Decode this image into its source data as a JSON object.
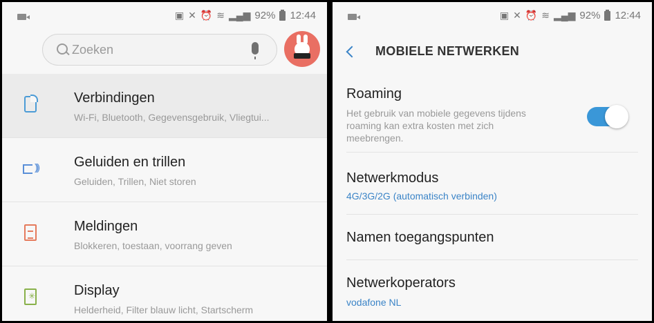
{
  "status_bar": {
    "battery": "92%",
    "time": "12:44",
    "icons": [
      "video-camera-icon",
      "nfc-icon",
      "mute-icon",
      "alarm-icon",
      "wifi-icon",
      "signal-icon",
      "battery-icon"
    ]
  },
  "left_screen": {
    "search": {
      "placeholder": "Zoeken"
    },
    "items": [
      {
        "title": "Verbindingen",
        "subtitle": "Wi-Fi, Bluetooth, Gegevensgebruik, Vliegtui...",
        "icon": "connections-icon"
      },
      {
        "title": "Geluiden en trillen",
        "subtitle": "Geluiden, Trillen, Niet storen",
        "icon": "sound-icon"
      },
      {
        "title": "Meldingen",
        "subtitle": "Blokkeren, toestaan, voorrang geven",
        "icon": "notifications-icon"
      },
      {
        "title": "Display",
        "subtitle": "Helderheid, Filter blauw licht, Startscherm",
        "icon": "display-icon"
      }
    ]
  },
  "right_screen": {
    "header_title": "MOBIELE NETWERKEN",
    "roaming": {
      "title": "Roaming",
      "description": "Het gebruik van mobiele gegevens tijdens roaming kan extra kosten met zich meebrengen.",
      "enabled": true
    },
    "network_mode": {
      "title": "Netwerkmodus",
      "value": "4G/3G/2G (automatisch verbinden)"
    },
    "apn": {
      "title": "Namen toegangspunten"
    },
    "operators": {
      "title": "Netwerkoperators",
      "value": "vodafone NL"
    }
  },
  "colors": {
    "accent": "#3b84c7",
    "toggle_on": "#3a97d8",
    "avatar_bg": "#e96f63"
  }
}
